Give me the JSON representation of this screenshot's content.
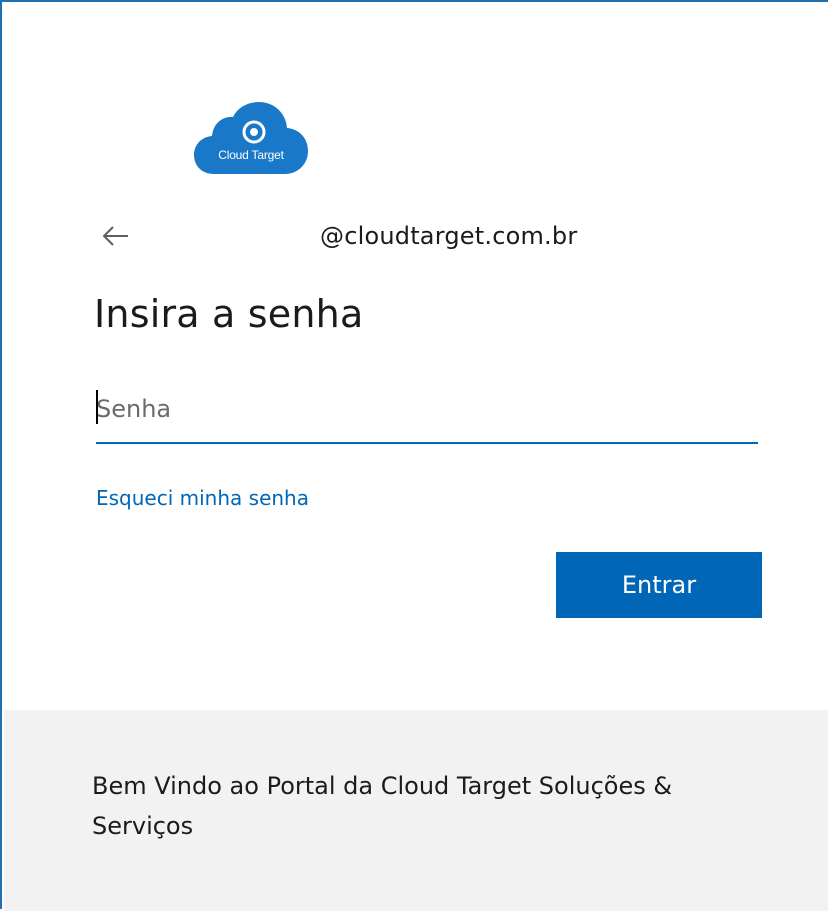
{
  "logo": {
    "text": "Cloud Target",
    "icon": "cloud-target-logo",
    "color": "#1a78c8"
  },
  "header": {
    "back_icon": "arrow-left-icon",
    "identity": "@cloudtarget.com.br"
  },
  "main": {
    "title": "Insira a senha",
    "password_placeholder": "Senha",
    "password_value": "",
    "forgot_link": "Esqueci minha senha",
    "submit_label": "Entrar"
  },
  "footer": {
    "text": "Bem Vindo ao Portal da Cloud Target Soluções & Serviços"
  },
  "colors": {
    "accent": "#0067b8",
    "footer_bg": "#f2f2f2",
    "border": "#1f6fb5"
  }
}
